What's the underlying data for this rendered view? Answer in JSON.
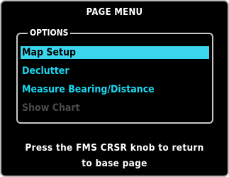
{
  "window": {
    "title": "PAGE MENU"
  },
  "options": {
    "label": "OPTIONS",
    "items": [
      {
        "label": "Map Setup",
        "state": "selected"
      },
      {
        "label": "Declutter",
        "state": "enabled"
      },
      {
        "label": "Measure Bearing/Distance",
        "state": "enabled"
      },
      {
        "label": "Show Chart",
        "state": "disabled"
      }
    ]
  },
  "footer": {
    "line1": "Press the FMS CRSR knob to return",
    "line2": "to base page"
  },
  "colors": {
    "background": "#000000",
    "menu_text": "#19d8f0",
    "selection": "#3ad6ec",
    "disabled_text": "#4a4a4a",
    "title_text": "#ffffff"
  }
}
